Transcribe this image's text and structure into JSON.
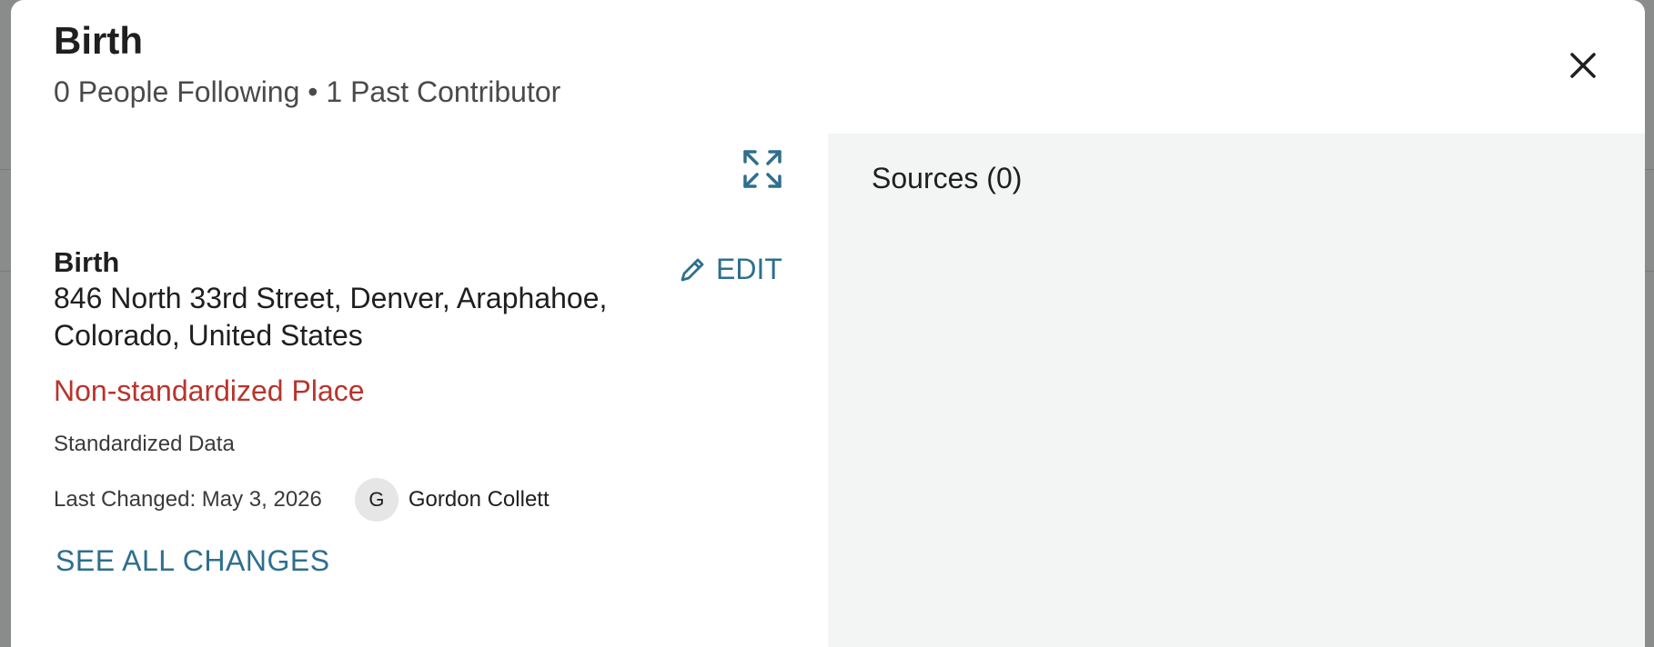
{
  "header": {
    "title": "Birth",
    "subtitle": "0 People Following • 1 Past Contributor"
  },
  "icons": {
    "close": "close-icon",
    "expand": "expand-icon",
    "edit": "pencil-icon"
  },
  "fact": {
    "type": "Birth",
    "place": "846 North 33rd Street, Denver, Araphahoe, Colorado, United States",
    "edit_label": "EDIT",
    "warning": "Non-standardized Place",
    "standardized_label": "Standardized Data",
    "last_changed": "Last Changed: May 3, 2026",
    "contributor_initial": "G",
    "contributor_name": "Gordon Collett",
    "see_all_label": "SEE ALL CHANGES"
  },
  "sources": {
    "title": "Sources (0)"
  },
  "colors": {
    "link": "#2e6f8e",
    "warning": "#b8342c",
    "panel_bg": "#f3f5f4"
  }
}
